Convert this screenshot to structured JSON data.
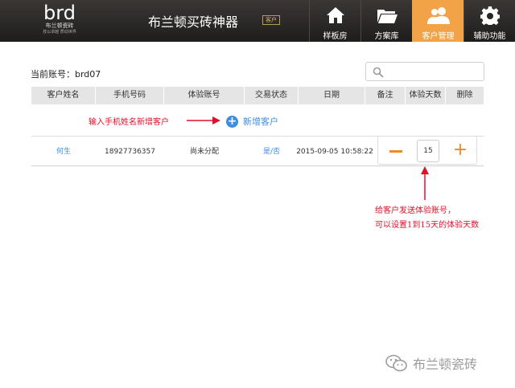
{
  "header": {
    "logo_mark": "brd",
    "logo_sub": "布兰顿瓷砖",
    "logo_tagline": "技以卓越 质动世界",
    "app_title": "布兰顿买砖神器",
    "version_badge": "客户",
    "nav": [
      {
        "label": "样板房",
        "icon": "home-icon",
        "active": false
      },
      {
        "label": "方案库",
        "icon": "folder-icon",
        "active": false
      },
      {
        "label": "客户管理",
        "icon": "users-icon",
        "active": true
      },
      {
        "label": "辅助功能",
        "icon": "gear-icon",
        "active": false
      }
    ],
    "active_color": "#f2a347"
  },
  "account": {
    "label": "当前账号：brd07"
  },
  "search": {
    "placeholder": ""
  },
  "table": {
    "headers": [
      "客户姓名",
      "手机号码",
      "体验账号",
      "交易状态",
      "日期",
      "备注",
      "体验天数",
      "删除"
    ],
    "add_button_label": "新增客户",
    "hint_add": "输入手机姓名新增客户",
    "rows": [
      {
        "name": "何生",
        "phone": "18927736357",
        "trial_account": "尚未分配",
        "status": "是/否",
        "date": "2015-09-05 10:58:22",
        "days": "15"
      }
    ]
  },
  "hint_days": {
    "line1": "给客户发送体验账号，",
    "line2": "可以设置1到15天的体验天数"
  },
  "watermark": {
    "text": "布兰顿瓷砖",
    "icon": "wechat-icon"
  },
  "colors": {
    "link": "#3c8ee0",
    "annotation": "#e0102a",
    "stepper": "#f08a24"
  }
}
